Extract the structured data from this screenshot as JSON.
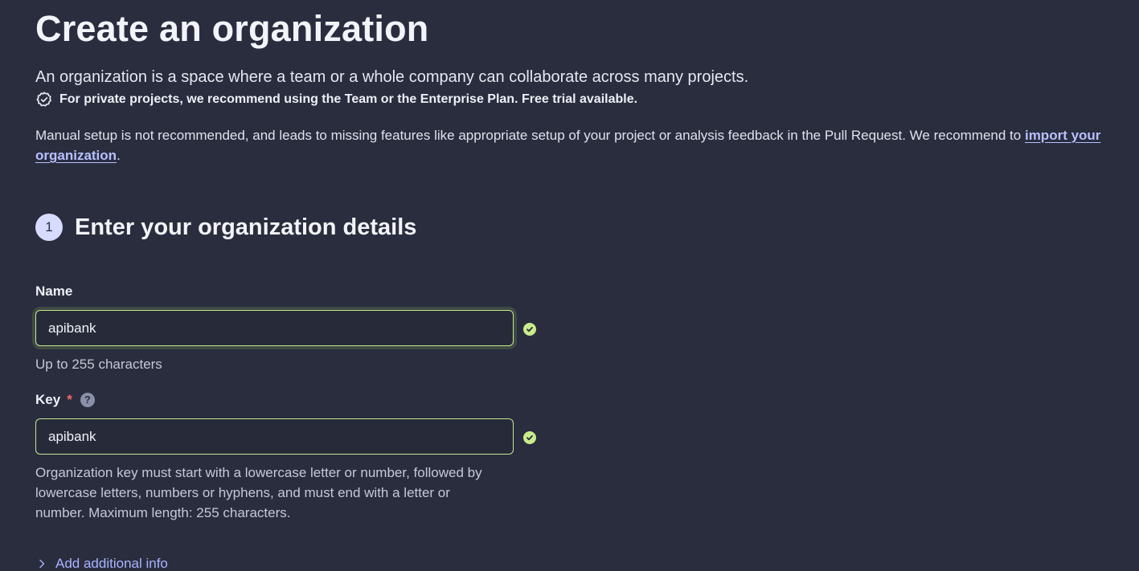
{
  "header": {
    "title": "Create an organization",
    "intro": "An organization is a space where a team or a whole company can collaborate across many projects.",
    "recommendation": "For private projects, we recommend using the Team or the Enterprise Plan. Free trial available.",
    "recommendation_icon": "badge-check-icon",
    "manual_text": "Manual setup is not recommended, and leads to missing features like appropriate setup of your project or analysis feedback in the Pull Request. We recommend to ",
    "import_link": "import your organization",
    "manual_suffix": "."
  },
  "step": {
    "number": "1",
    "title": "Enter your organization details"
  },
  "form": {
    "name": {
      "label": "Name",
      "value": "apibank",
      "hint": "Up to 255 characters",
      "valid_icon": "check-circle-icon"
    },
    "key": {
      "label": "Key",
      "required_marker": "*",
      "help_icon_text": "?",
      "value": "apibank",
      "hint_line1": "Organization key must start with a lowercase letter or number, followed by",
      "hint_line2": "lowercase letters, numbers or hyphens, and must end with a letter or",
      "hint_line3": "number. Maximum length: 255 characters.",
      "valid_icon": "check-circle-icon"
    },
    "additional_info_label": "Add additional info"
  },
  "colors": {
    "background": "#292d3e",
    "accent_link": "#b7c0ff",
    "valid_green": "#c9ec8a",
    "required_red": "#f26a6a"
  }
}
